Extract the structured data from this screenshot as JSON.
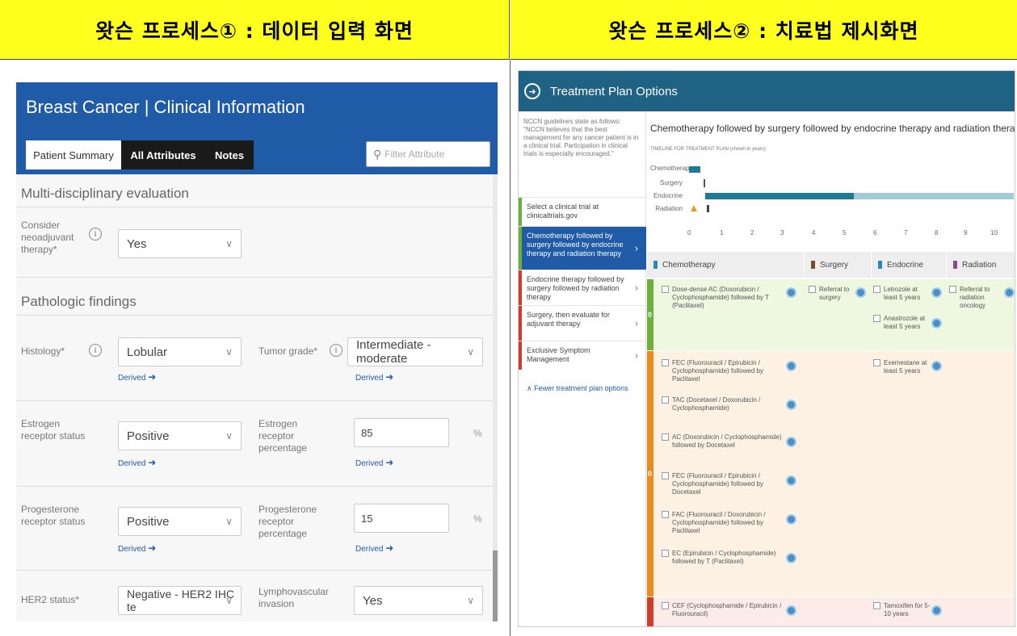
{
  "captions": {
    "left": "왓슨 프로세스① : 데이터 입력 화면",
    "right": "왓슨 프로세스② : 치료법 제시화면"
  },
  "left_panel": {
    "title": "Breast Cancer | Clinical Information",
    "tabs": [
      "Patient Summary",
      "All Attributes",
      "Notes"
    ],
    "filter_placeholder": "Filter Attribute",
    "sections": {
      "multi": "Multi-disciplinary evaluation",
      "path": "Pathologic findings"
    },
    "fields": {
      "neoadjuvant": {
        "label": "Consider neoadjuvant therapy*",
        "value": "Yes"
      },
      "histology": {
        "label": "Histology*",
        "value": "Lobular",
        "derived": "Derived"
      },
      "tumor_grade": {
        "label": "Tumor grade*",
        "value": "Intermediate - moderate",
        "derived": "Derived"
      },
      "er_status": {
        "label": "Estrogen receptor status",
        "value": "Positive",
        "derived": "Derived"
      },
      "er_pct": {
        "label": "Estrogen receptor percentage",
        "value": "85",
        "unit": "%",
        "derived": "Derived"
      },
      "pr_status": {
        "label": "Progesterone receptor status",
        "value": "Positive",
        "derived": "Derived"
      },
      "pr_pct": {
        "label": "Progesterone receptor percentage",
        "value": "15",
        "unit": "%",
        "derived": "Derived"
      },
      "her2": {
        "label": "HER2 status*",
        "value": "Negative - HER2 IHC te"
      },
      "lymph": {
        "label": "Lymphovascular invasion",
        "value": "Yes"
      }
    },
    "info_glyph": "i"
  },
  "right_panel": {
    "title": "Treatment Plan Options",
    "intro": "NCCN guidelines state as follows: \"NCCN believes that the best management for any cancer patient is in a clinical trial. Participation in clinical trials is especially encouraged.\"",
    "side_items": [
      {
        "label": "Select a clinical trial at clinicaltrials.gov",
        "color": "#6bb03a"
      },
      {
        "label": "Chemotherapy followed by surgery followed by endocrine therapy and radiation therapy",
        "color": "#6bb03a"
      },
      {
        "label": "Endocrine therapy followed by surgery followed by radiation therapy",
        "color": "#d43a2a"
      },
      {
        "label": "Surgery, then evaluate for adjuvant therapy",
        "color": "#d43a2a"
      },
      {
        "label": "Exclusive Symptom Management",
        "color": "#d43a2a"
      }
    ],
    "fewer_link": "Fewer treatment plan options",
    "plan_title": "Chemotherapy followed by surgery followed by endocrine therapy and radiation therapy",
    "timeline_caption": "TIMELINE FOR TREATMENT PLAN (shown in years)",
    "timeline_labels": [
      "Chemotherapy",
      "Surgery",
      "Endocrine",
      "Radiation"
    ],
    "timeline_ticks": [
      "0",
      "1",
      "2",
      "3",
      "4",
      "5",
      "6",
      "7",
      "8",
      "9",
      "10"
    ],
    "columns": [
      {
        "name": "Chemotherapy",
        "color": "#2a8ab2"
      },
      {
        "name": "Surgery",
        "color": "#7a4a2a"
      },
      {
        "name": "Endocrine",
        "color": "#2a8ab2"
      },
      {
        "name": "Radiation",
        "color": "#8a4a9a"
      }
    ],
    "row_marker": "0",
    "row1": {
      "chemo": [
        "Dose-dense AC (Doxorubicin / Cyclophosphamide) followed by T (Paclitaxel)"
      ],
      "surgery": [
        "Referral to surgery"
      ],
      "endocrine": [
        "Letrozole at least 5 years",
        "Anastrozole at least 5 years"
      ],
      "radiation": [
        "Referral to radiation oncology"
      ]
    },
    "row2": {
      "chemo": [
        "FEC (Fluorouracil / Epirubicin / Cyclophosphamide) followed by Paclitaxel",
        "TAC (Docetaxel / Doxorubicin / Cyclophosphamide)",
        "AC (Doxorubicin / Cyclophosphamide) followed by Docetaxel",
        "FEC (Fluorouracil / Epirubicin / Cyclophosphamide) followed by Docetaxel",
        "FAC (Fluorouracil / Doxorubicin / Cyclophosphamide) followed by Paclitaxel",
        "EC (Epirubicin / Cyclophosphamide) followed by T (Paclitaxel)"
      ],
      "endocrine": [
        "Exemestane at least 5 years"
      ]
    },
    "row3": {
      "chemo": [
        "CEF (Cyclophosphamide / Epirubicin / Fluorouracil)"
      ],
      "endocrine": [
        "Tamoxifen for 5-10 years"
      ]
    }
  }
}
